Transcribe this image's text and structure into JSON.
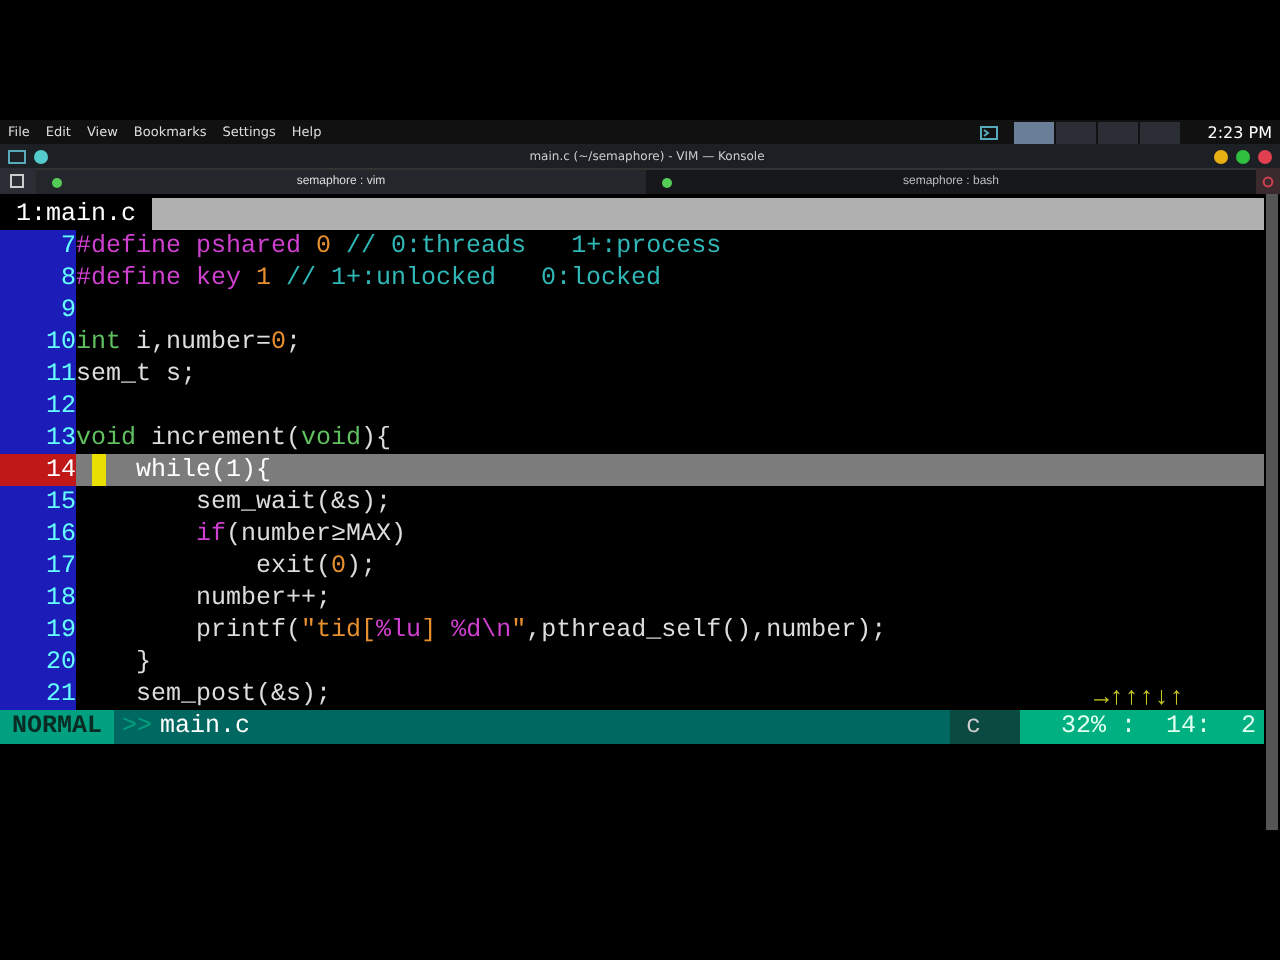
{
  "menu_bar": [
    "File",
    "Edit",
    "View",
    "Bookmarks",
    "Settings",
    "Help"
  ],
  "panel": {
    "clock": "2:23 PM"
  },
  "window": {
    "title": "main.c (~/semaphore) - VIM — Konsole"
  },
  "tabs": [
    {
      "label": "semaphore : vim",
      "selected": true
    },
    {
      "label": "semaphore : bash",
      "selected": false
    }
  ],
  "vim": {
    "tabline": [
      {
        "label": "1:main.c",
        "selected": true
      }
    ],
    "lines": [
      {
        "number": "7",
        "current": false,
        "segments": [
          {
            "text": "#define pshared ",
            "kind": "preproc"
          },
          {
            "text": "0",
            "kind": "number"
          },
          {
            "text": " // 0:threads   1+:process",
            "kind": "comment"
          }
        ]
      },
      {
        "number": "8",
        "current": false,
        "segments": [
          {
            "text": "#define key ",
            "kind": "preproc"
          },
          {
            "text": "1",
            "kind": "number"
          },
          {
            "text": " // 1+:unlocked   0:locked",
            "kind": "comment"
          }
        ]
      },
      {
        "number": "9",
        "current": false
      },
      {
        "number": "10",
        "current": false,
        "segments": [
          {
            "text": "int",
            "kind": "type"
          },
          {
            "text": " i,number=",
            "kind": "plain"
          },
          {
            "text": "0",
            "kind": "number"
          },
          {
            "text": ";",
            "kind": "plain"
          }
        ]
      },
      {
        "number": "11",
        "current": false,
        "segments": [
          {
            "text": "sem_t s;",
            "kind": "plain"
          }
        ]
      },
      {
        "number": "12",
        "current": false
      },
      {
        "number": "13",
        "current": false,
        "segments": [
          {
            "text": "void",
            "kind": "type"
          },
          {
            "text": " increment(",
            "kind": "plain"
          },
          {
            "text": "void",
            "kind": "type"
          },
          {
            "text": "){",
            "kind": "plain"
          }
        ]
      },
      {
        "number": "14",
        "current": true,
        "segments": [
          {
            "kind": "cursor"
          },
          {
            "text": "  while(1){",
            "kind": "plain"
          }
        ]
      },
      {
        "number": "15",
        "current": false,
        "segments": [
          {
            "text": "        sem_wait(&s);",
            "kind": "plain"
          }
        ]
      },
      {
        "number": "16",
        "current": false,
        "segments": [
          {
            "text": "        if",
            "kind": "keyword"
          },
          {
            "text": "(number≥MAX)",
            "kind": "plain"
          }
        ]
      },
      {
        "number": "17",
        "current": false,
        "segments": [
          {
            "text": "            exit(",
            "kind": "plain"
          },
          {
            "text": "0",
            "kind": "number"
          },
          {
            "text": ");",
            "kind": "plain"
          }
        ]
      },
      {
        "number": "18",
        "current": false,
        "segments": [
          {
            "text": "        number++;",
            "kind": "plain"
          }
        ]
      },
      {
        "number": "19",
        "current": false,
        "segments": [
          {
            "text": "        printf(",
            "kind": "plain"
          },
          {
            "text": "\"tid[",
            "kind": "string"
          },
          {
            "text": "%lu",
            "kind": "format"
          },
          {
            "text": "] ",
            "kind": "string"
          },
          {
            "text": "%d",
            "kind": "format"
          },
          {
            "text": "\\n",
            "kind": "format"
          },
          {
            "text": "\"",
            "kind": "string"
          },
          {
            "text": ",pthread_self(),number);",
            "kind": "plain"
          }
        ]
      },
      {
        "number": "20",
        "current": false,
        "segments": [
          {
            "text": "    }",
            "kind": "plain"
          }
        ]
      },
      {
        "number": "21",
        "current": false,
        "segments": [
          {
            "text": "    sem_post(&s);",
            "kind": "plain"
          }
        ]
      }
    ],
    "command_line": "→↑↑↑↓↑",
    "status": {
      "mode": "NORMAL",
      "separator": ">>",
      "file": "main.c",
      "filetype": "c",
      "position": "32% :  14:  2"
    }
  }
}
